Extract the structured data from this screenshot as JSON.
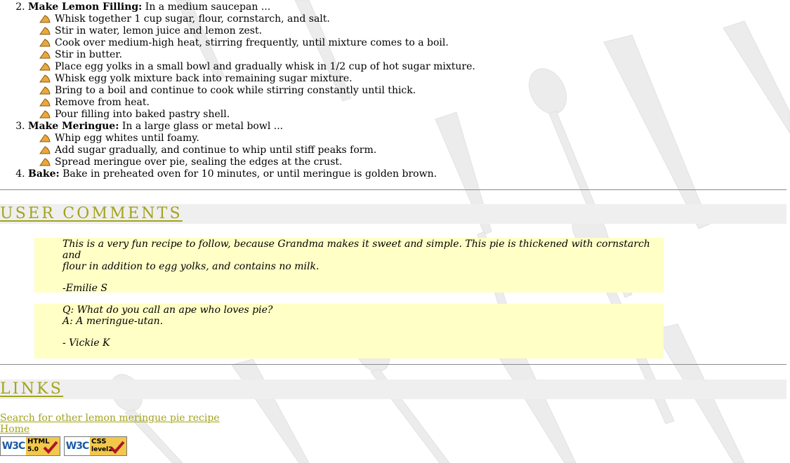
{
  "steps": [
    {
      "number": "2.",
      "title": "Make Lemon Filling:",
      "intro": " In a medium saucepan ...",
      "items": [
        "Whisk together 1 cup sugar, flour, cornstarch, and salt.",
        "Stir in water, lemon juice and lemon zest.",
        "Cook over medium-high heat, stirring frequently, until mixture comes to a boil.",
        "Stir in butter.",
        "Place egg yolks in a small bowl and gradually whisk in 1/2 cup of hot sugar mixture.",
        "Whisk egg yolk mixture back into remaining sugar mixture.",
        "Bring to a boil and continue to cook while stirring constantly until thick.",
        "Remove from heat.",
        "Pour filling into baked pastry shell."
      ]
    },
    {
      "number": "3.",
      "title": "Make Meringue:",
      "intro": " In a large glass or metal bowl ...",
      "items": [
        "Whip egg whites until foamy.",
        "Add sugar gradually, and continue to whip until stiff peaks form.",
        "Spread meringue over pie, sealing the edges at the crust."
      ]
    },
    {
      "number": "4.",
      "title": "Bake:",
      "intro": " Bake in preheated oven for 10 minutes, or until meringue is golden brown."
    }
  ],
  "comments_section": {
    "heading": "USER COMMENTS",
    "comments": [
      {
        "line1": "This is a very fun recipe to follow, because Grandma makes it sweet and simple. This pie is thickened with cornstarch and",
        "line2": "flour in addition to egg yolks, and contains no milk.",
        "author": "-Emilie S"
      },
      {
        "line1": "Q: What do you call an ape who loves pie?",
        "line2": "A: A meringue-utan.",
        "author": "- Vickie K"
      }
    ]
  },
  "links_section": {
    "heading": "LINKS",
    "links": [
      "Search for other lemon meringue pie recipe",
      "Home"
    ],
    "badges": [
      {
        "logo": "W3C",
        "kind": "HTML",
        "version": "5.0"
      },
      {
        "logo": "W3C",
        "kind": "CSS",
        "version": "level2"
      }
    ]
  },
  "colors": {
    "accent": "#a3a31c",
    "comment_bg": "#ffffc6",
    "section_bg": "#efefef",
    "badge_bg": "#f2c84b",
    "check": "#b0122a"
  },
  "icons": {
    "bullet": "pie-slice-icon",
    "background": "cutlery-icon",
    "badge_mark": "checkmark-icon"
  }
}
